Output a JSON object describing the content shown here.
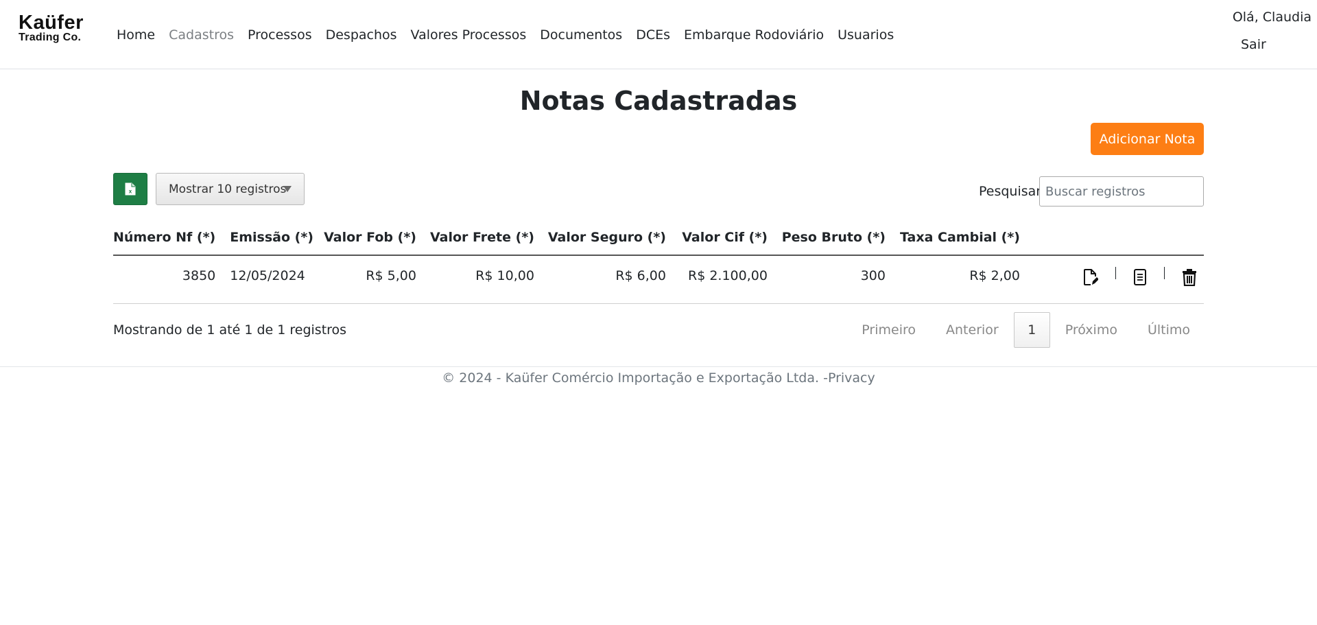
{
  "brand": {
    "line1": "Kaüfer",
    "line2": "Trading Co."
  },
  "nav": {
    "items": [
      {
        "label": "Home"
      },
      {
        "label": "Cadastros"
      },
      {
        "label": "Processos"
      },
      {
        "label": "Despachos"
      },
      {
        "label": "Valores Processos"
      },
      {
        "label": "Documentos"
      },
      {
        "label": "DCEs"
      },
      {
        "label": "Embarque Rodoviário"
      },
      {
        "label": "Usuarios"
      }
    ],
    "active_muted": "Cadastros"
  },
  "user": {
    "greeting": "Olá, Claudia",
    "logout_label": "Sair"
  },
  "page": {
    "title": "Notas Cadastradas",
    "add_button_label": "Adicionar Nota"
  },
  "toolbar": {
    "excel_icon": "excel-icon",
    "length_label": "Mostrar 10 registros",
    "search_label": "Pesquisar",
    "search_placeholder": "Buscar registros",
    "search_value": ""
  },
  "table": {
    "columns": [
      "Número Nf (*)",
      "Emissão (*)",
      "Valor Fob (*)",
      "Valor Frete (*)",
      "Valor Seguro (*)",
      "Valor Cif (*)",
      "Peso Bruto (*)",
      "Taxa Cambial (*)"
    ],
    "rows": [
      {
        "numero_nf": "3850",
        "emissao": "12/05/2024",
        "valor_fob": "R$ 5,00",
        "valor_frete": "R$ 10,00",
        "valor_seguro": "R$ 6,00",
        "valor_cif": "R$ 2.100,00",
        "peso_bruto": "300",
        "taxa_cambial": "R$ 2,00",
        "actions": [
          "edit-icon",
          "details-icon",
          "delete-icon"
        ]
      }
    ]
  },
  "info": {
    "text": "Mostrando de 1 até 1 de 1 registros"
  },
  "pagination": {
    "first": "Primeiro",
    "previous": "Anterior",
    "current": "1",
    "next": "Próximo",
    "last": "Último"
  },
  "footer": {
    "text": "© 2024 - Kaüfer Comércio Importação e Exportação Ltda. -",
    "privacy_label": "Privacy"
  },
  "colors": {
    "accent": "#fd7e14",
    "excel": "#1e7e45",
    "muted_nav": "#7b7f83"
  }
}
